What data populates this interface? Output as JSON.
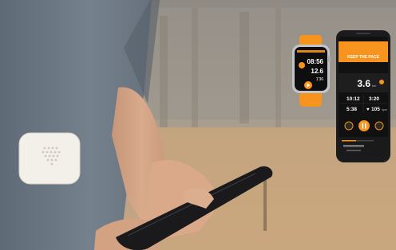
{
  "watch": {
    "big_value": "08:56",
    "mid_value": "12.6",
    "small_value": "1'36"
  },
  "phone": {
    "banner_title": "KEEP THE PACE",
    "distance": "3.6",
    "distance_unit": "km",
    "time_left": "10:12",
    "time_right": "3:20",
    "pace_left": "5:38",
    "pace_right": "105",
    "pace_right_unit": "bpm"
  },
  "colors": {
    "brand_orange": "#f7941d",
    "phone_bg": "#111111",
    "shirt": "#6e7a86",
    "sky_trees": "#a39a8c",
    "grass": "#c7a57f"
  }
}
